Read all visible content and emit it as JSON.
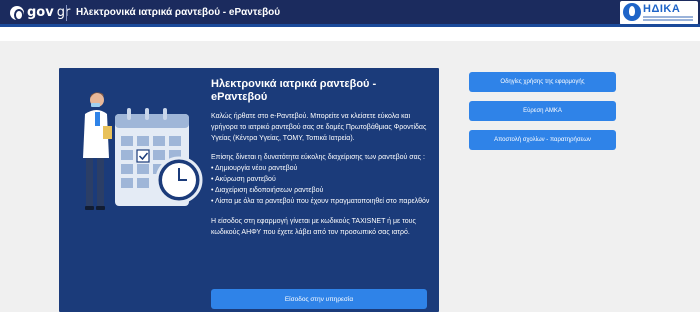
{
  "header": {
    "logo_text_bold": "gov",
    "logo_text_light": "gr",
    "app_title": "Ηλεκτρονικά ιατρικά ραντεβού - eΡαντεβού",
    "partner_logo": "ΗΔΙΚΑ"
  },
  "card": {
    "title": "Ηλεκτρονικά ιατρικά ραντεβού - eΡαντεβού",
    "intro": "Καλώς ήρθατε στο e-Ραντεβού. Μπορείτε να κλείσετε εύκολα και γρήγορα το ιατρικό ραντεβού σας σε δομές Πρωτοβάθμιας Φροντίδας Υγείας (Κέντρα Υγείας, ΤΟΜΥ, Τοπικά Ιατρεία).",
    "features_intro": "Επίσης δίνεται η δυνατότητα εύκολης διαχείρισης των ραντεβού σας :",
    "features": [
      "• Δημιουργία νέου ραντεβού",
      "• Ακύρωση ραντεβού",
      "• Διαχείριση ειδοποιήσεων ραντεβού",
      "• Λίστα με όλα τα ραντεβού που έχουν πραγματοποιηθεί στο παρελθόν"
    ],
    "login_note": "Η είσοδος στη εφαρμογή γίνεται με κωδικούς TAXISNET ή με τους κωδικούς ΑΗΦΥ που έχετε λάβει από τον προσωπικό σας ιατρό.",
    "login_button": "Είσοδος στην υπηρεσία"
  },
  "side_buttons": [
    "Οδηγίες χρήσης της εφαρμογής",
    "Εύρεση ΑΜΚΑ",
    "Αποστολή σχολίων - παρατηρήσεων"
  ],
  "colors": {
    "header_bg": "#1b2b5e",
    "card_bg": "#1b3b7a",
    "button_bg": "#2f83e8",
    "page_bg": "#f0f0f0"
  }
}
